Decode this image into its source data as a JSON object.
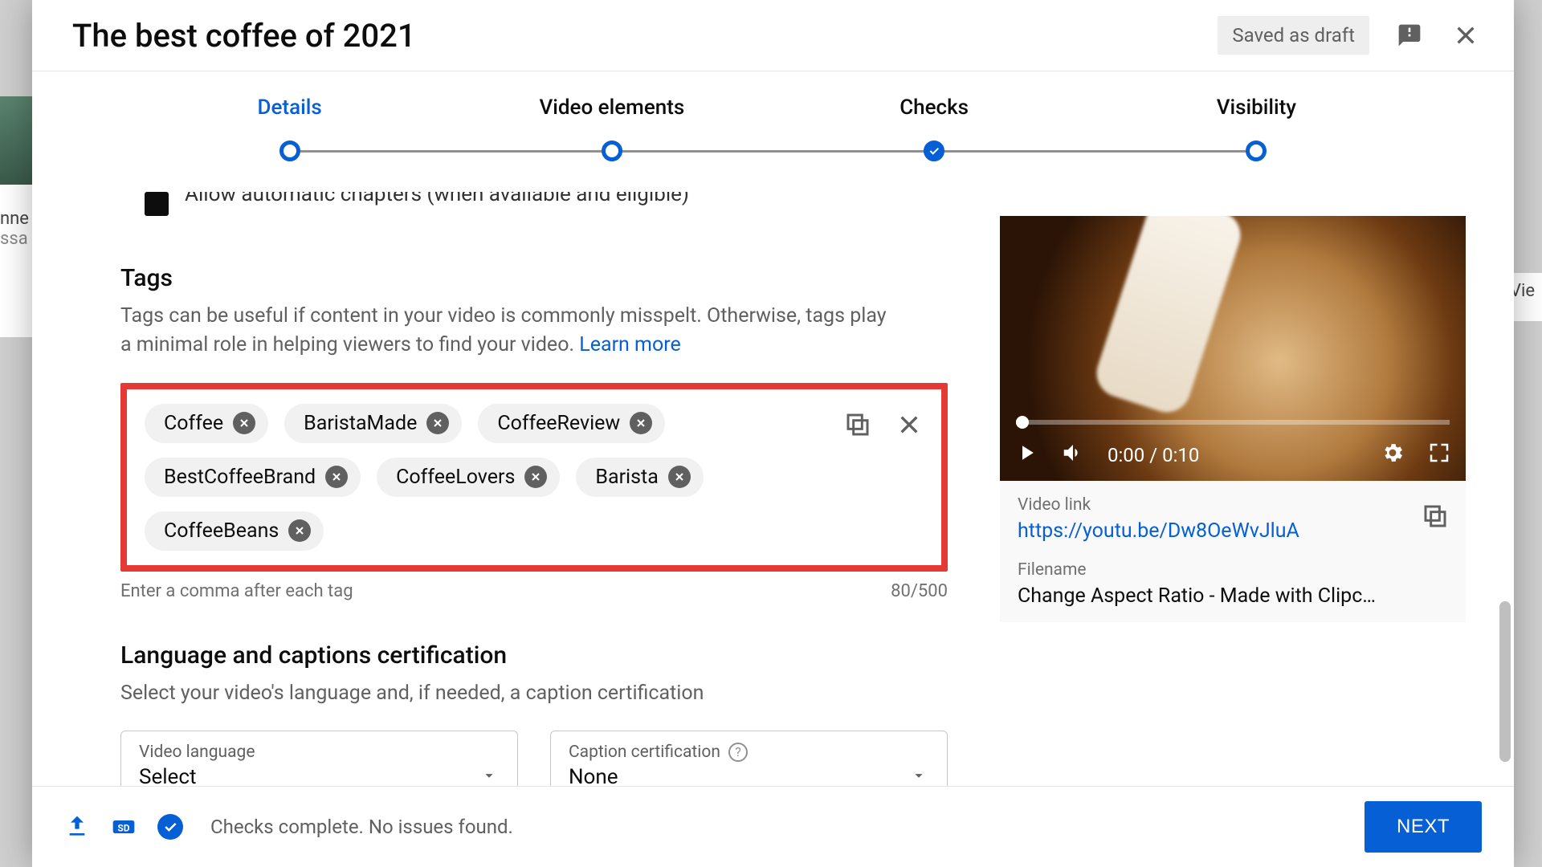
{
  "header": {
    "title": "The best coffee of 2021",
    "saved_label": "Saved as draft"
  },
  "steps": [
    {
      "label": "Details",
      "state": "active"
    },
    {
      "label": "Video elements",
      "state": "pending"
    },
    {
      "label": "Checks",
      "state": "done"
    },
    {
      "label": "Visibility",
      "state": "pending"
    }
  ],
  "cutoff_text": "Allow automatic chapters (when available and eligible)",
  "tags": {
    "title": "Tags",
    "description": "Tags can be useful if content in your video is commonly misspelt. Otherwise, tags play a minimal role in helping viewers to find your video. ",
    "learn_more": "Learn more",
    "items": [
      "Coffee",
      "BaristaMade",
      "CoffeeReview",
      "BestCoffeeBrand",
      "CoffeeLovers",
      "Barista",
      "CoffeeBeans"
    ],
    "helper": "Enter a comma after each tag",
    "counter": "80/500"
  },
  "lang": {
    "title": "Language and captions certification",
    "description": "Select your video's language and, if needed, a caption certification",
    "video_language_label": "Video language",
    "video_language_value": "Select",
    "caption_label": "Caption certification",
    "caption_value": "None"
  },
  "preview": {
    "time": "0:00 / 0:10",
    "link_label": "Video link",
    "link_value": "https://youtu.be/Dw8OeWvJluA",
    "filename_label": "Filename",
    "filename_value": "Change Aspect Ratio - Made with Clipc…"
  },
  "footer": {
    "status": "Checks complete. No issues found.",
    "next": "NEXT"
  },
  "right_peek": "Vie",
  "left_peek1": "nne",
  "left_peek2": "ssa"
}
